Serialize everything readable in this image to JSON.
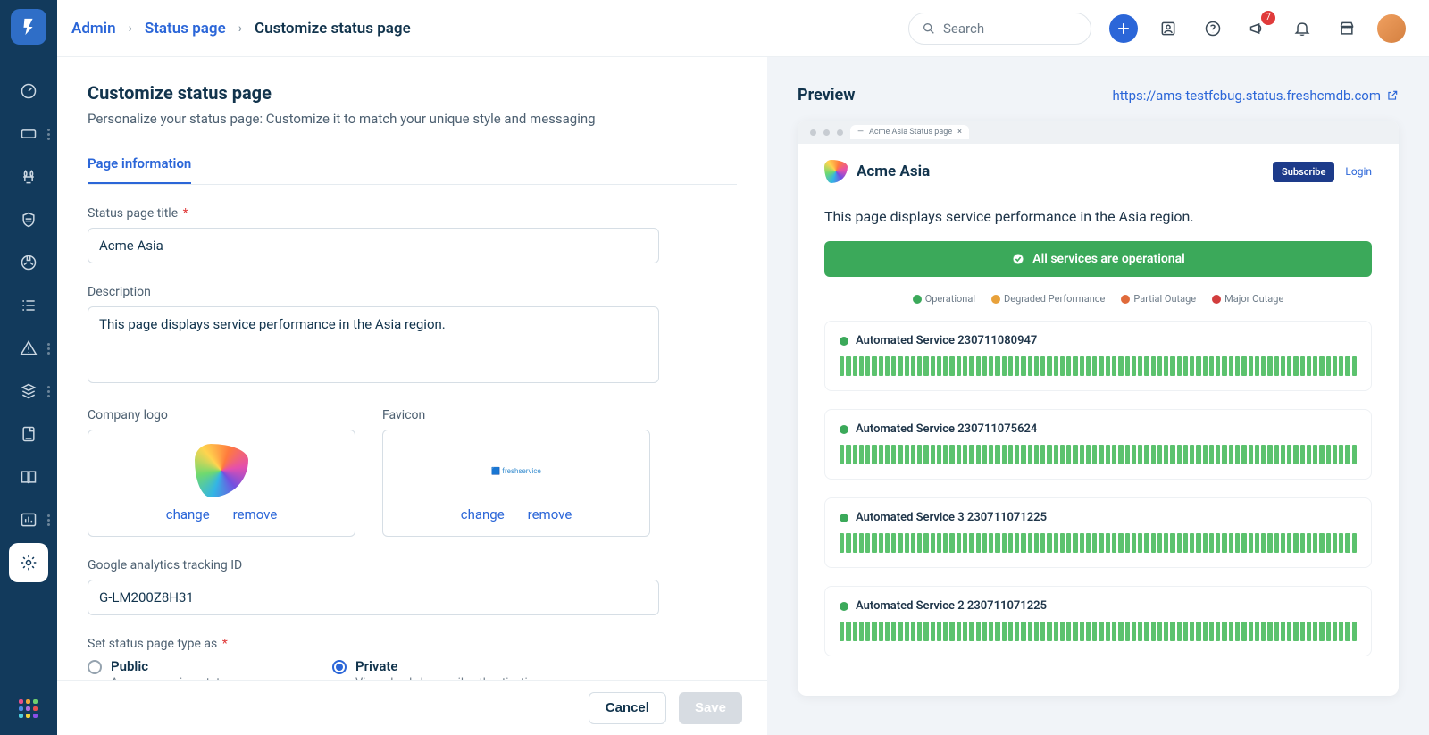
{
  "breadcrumbs": {
    "admin": "Admin",
    "status_page": "Status page",
    "current": "Customize status page"
  },
  "header": {
    "search_placeholder": "Search",
    "notification_count": "7"
  },
  "page": {
    "title": "Customize status page",
    "subtitle": "Personalize your status page: Customize it to match your unique style and messaging",
    "tab": "Page information"
  },
  "form": {
    "title_label": "Status page title",
    "title_value": "Acme Asia",
    "desc_label": "Description",
    "desc_value": "This page displays service performance in the Asia region.",
    "logo_label": "Company logo",
    "favicon_label": "Favicon",
    "change": "change",
    "remove": "remove",
    "ga_label": "Google analytics tracking ID",
    "ga_value": "G-LM200Z8H31",
    "type_label": "Set status page type as",
    "public": {
      "label": "Public",
      "hint": "Anyone can view status page"
    },
    "private": {
      "label": "Private",
      "hint": "Viewed only by email authentication"
    },
    "selected": "private"
  },
  "buttons": {
    "cancel": "Cancel",
    "save": "Save"
  },
  "preview": {
    "heading": "Preview",
    "url": "https://ams-testfcbug.status.freshcmdb.com",
    "tab_title": "Acme Asia Status page",
    "brand": "Acme Asia",
    "subscribe": "Subscribe",
    "login": "Login",
    "desc": "This page displays service performance in the Asia region.",
    "banner": "All services are operational",
    "legend": {
      "ok": "Operational",
      "warn": "Degraded Performance",
      "part": "Partial Outage",
      "maj": "Major Outage"
    },
    "services": [
      {
        "name": "Automated Service 230711080947"
      },
      {
        "name": "Automated Service 230711075624"
      },
      {
        "name": "Automated Service 3 230711071225"
      },
      {
        "name": "Automated Service 2 230711071225"
      }
    ]
  }
}
